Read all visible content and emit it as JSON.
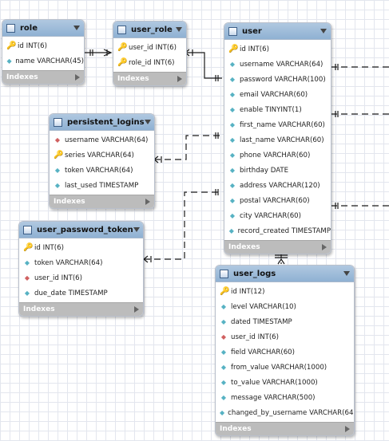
{
  "tables": [
    {
      "id": "role",
      "name": "role",
      "columns": [
        {
          "text": "id INT(6)",
          "kind": "pk"
        },
        {
          "text": "name VARCHAR(45)",
          "kind": "col"
        }
      ],
      "footer": "Indexes"
    },
    {
      "id": "user_role",
      "name": "user_role",
      "columns": [
        {
          "text": "user_id INT(6)",
          "kind": "fkpk"
        },
        {
          "text": "role_id INT(6)",
          "kind": "fkpk"
        }
      ],
      "footer": "Indexes"
    },
    {
      "id": "user",
      "name": "user",
      "columns": [
        {
          "text": "id INT(6)",
          "kind": "pk"
        },
        {
          "text": "username VARCHAR(64)",
          "kind": "col"
        },
        {
          "text": "password VARCHAR(100)",
          "kind": "col"
        },
        {
          "text": "email VARCHAR(60)",
          "kind": "col"
        },
        {
          "text": "enable TINYINT(1)",
          "kind": "col"
        },
        {
          "text": "first_name VARCHAR(60)",
          "kind": "col"
        },
        {
          "text": "last_name VARCHAR(60)",
          "kind": "col"
        },
        {
          "text": "phone VARCHAR(60)",
          "kind": "col"
        },
        {
          "text": "birthday DATE",
          "kind": "col"
        },
        {
          "text": "address VARCHAR(120)",
          "kind": "col"
        },
        {
          "text": "postal VARCHAR(60)",
          "kind": "col"
        },
        {
          "text": "city VARCHAR(60)",
          "kind": "col"
        },
        {
          "text": "record_created TIMESTAMP",
          "kind": "col"
        }
      ],
      "footer": "Indexes"
    },
    {
      "id": "persistent_logins",
      "name": "persistent_logins",
      "columns": [
        {
          "text": "username VARCHAR(64)",
          "kind": "fk"
        },
        {
          "text": "series VARCHAR(64)",
          "kind": "pk"
        },
        {
          "text": "token VARCHAR(64)",
          "kind": "col"
        },
        {
          "text": "last_used TIMESTAMP",
          "kind": "col"
        }
      ],
      "footer": "Indexes"
    },
    {
      "id": "user_password_token",
      "name": "user_password_token",
      "columns": [
        {
          "text": "id INT(6)",
          "kind": "pk"
        },
        {
          "text": "token VARCHAR(64)",
          "kind": "col"
        },
        {
          "text": "user_id INT(6)",
          "kind": "fk"
        },
        {
          "text": "due_date TIMESTAMP",
          "kind": "col"
        }
      ],
      "footer": "Indexes"
    },
    {
      "id": "user_logs",
      "name": "user_logs",
      "columns": [
        {
          "text": "id INT(12)",
          "kind": "pk"
        },
        {
          "text": "level VARCHAR(10)",
          "kind": "col"
        },
        {
          "text": "dated TIMESTAMP",
          "kind": "col"
        },
        {
          "text": "user_id INT(6)",
          "kind": "fk"
        },
        {
          "text": "field VARCHAR(60)",
          "kind": "col"
        },
        {
          "text": "from_value VARCHAR(1000)",
          "kind": "col"
        },
        {
          "text": "to_value VARCHAR(1000)",
          "kind": "col"
        },
        {
          "text": "message VARCHAR(500)",
          "kind": "col"
        },
        {
          "text": "changed_by_username VARCHAR(64)",
          "kind": "col"
        }
      ],
      "footer": "Indexes"
    }
  ],
  "colors": {
    "header": "#9dbad8",
    "footer": "#bcbcbc",
    "pk_key": "#e0b400",
    "fk_key": "#d06060",
    "column_diamond": "#57b2c3",
    "grid": "#e3e6ee"
  },
  "icons": {
    "table": "table-icon",
    "collapse": "chevron-down-icon",
    "expand": "chevron-right-icon",
    "pk": "key-icon",
    "fk": "foreign-key-diamond-icon",
    "col": "column-diamond-icon"
  }
}
